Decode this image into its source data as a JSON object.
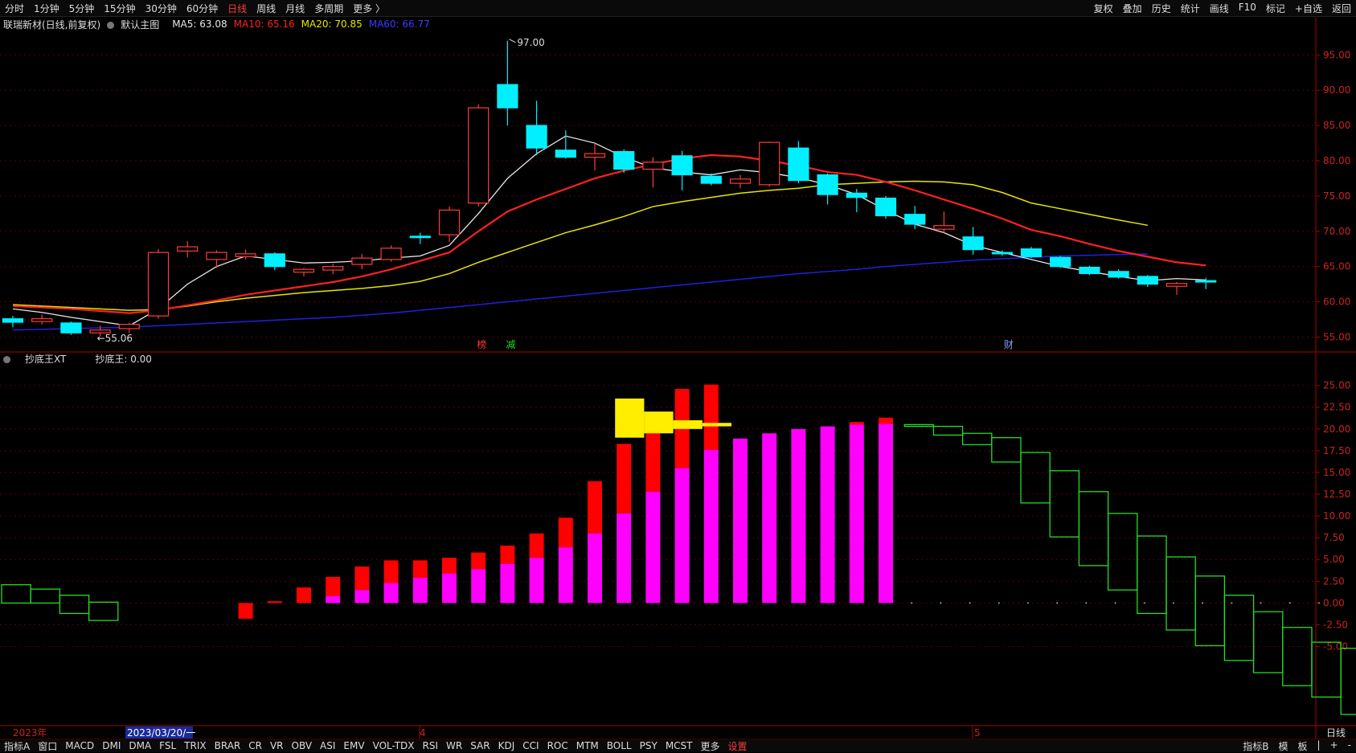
{
  "toolbar": {
    "periods": [
      "分时",
      "1分钟",
      "5分钟",
      "15分钟",
      "30分钟",
      "60分钟",
      "日线",
      "周线",
      "月线",
      "多周期",
      "更多 〉"
    ],
    "active_period": "日线",
    "right_items": [
      "复权",
      "叠加",
      "历史",
      "统计",
      "画线",
      "F10",
      "标记",
      "+自选",
      "返回"
    ]
  },
  "main_header": {
    "stock": "联瑞新材(日线,前复权)",
    "template": "默认主图",
    "ma5": "MA5: 63.08",
    "ma10": "MA10: 65.16",
    "ma20": "MA20: 70.85",
    "ma60": "MA60: 66.77"
  },
  "sub_header": {
    "indicator": "抄底王XT",
    "value": "抄底王: 0.00"
  },
  "colors": {
    "up": "#ff3b3b",
    "down": "#00f0ff",
    "ma5": "#e8e8e8",
    "ma10": "#ff2020",
    "ma20": "#e6e600",
    "ma60": "#2020e0",
    "magenta": "#ff00ff",
    "red": "#ff0000",
    "yellow": "#ffee00",
    "green": "#22dd22",
    "axis": "#aa0000",
    "label": "#cc2222"
  },
  "chart_data": [
    {
      "type": "candlestick",
      "ylim": [
        53,
        98
      ],
      "y_ticks": [
        55,
        60,
        65,
        70,
        75,
        80,
        85,
        90,
        95
      ],
      "candles": [
        {
          "o": 57.6,
          "h": 58.0,
          "l": 56.4,
          "c": 57.1
        },
        {
          "o": 57.2,
          "h": 58.2,
          "l": 56.8,
          "c": 57.6
        },
        {
          "o": 57.0,
          "h": 57.2,
          "l": 55.3,
          "c": 55.6
        },
        {
          "o": 55.6,
          "h": 56.6,
          "l": 55.1,
          "c": 56.0
        },
        {
          "o": 56.2,
          "h": 57.0,
          "l": 55.6,
          "c": 56.8
        },
        {
          "o": 58.0,
          "h": 67.5,
          "l": 57.6,
          "c": 67.0
        },
        {
          "o": 67.2,
          "h": 68.6,
          "l": 66.3,
          "c": 67.8
        },
        {
          "o": 66.0,
          "h": 67.3,
          "l": 64.8,
          "c": 67.0
        },
        {
          "o": 66.4,
          "h": 67.4,
          "l": 66.0,
          "c": 66.8
        },
        {
          "o": 66.8,
          "h": 67.0,
          "l": 64.5,
          "c": 65.0
        },
        {
          "o": 64.2,
          "h": 64.8,
          "l": 63.6,
          "c": 64.6
        },
        {
          "o": 64.5,
          "h": 65.4,
          "l": 63.9,
          "c": 65.0
        },
        {
          "o": 65.3,
          "h": 66.8,
          "l": 64.6,
          "c": 66.2
        },
        {
          "o": 66.0,
          "h": 68.0,
          "l": 65.7,
          "c": 67.6
        },
        {
          "o": 69.3,
          "h": 69.8,
          "l": 68.2,
          "c": 69.1
        },
        {
          "o": 69.5,
          "h": 73.5,
          "l": 68.5,
          "c": 73.0
        },
        {
          "o": 74.0,
          "h": 88.0,
          "l": 73.5,
          "c": 87.5
        },
        {
          "o": 90.8,
          "h": 97.0,
          "l": 85.0,
          "c": 87.5
        },
        {
          "o": 85.0,
          "h": 88.5,
          "l": 80.8,
          "c": 81.8
        },
        {
          "o": 81.5,
          "h": 84.3,
          "l": 80.3,
          "c": 80.5
        },
        {
          "o": 80.5,
          "h": 82.5,
          "l": 78.6,
          "c": 81.0
        },
        {
          "o": 81.3,
          "h": 81.6,
          "l": 78.3,
          "c": 78.8
        },
        {
          "o": 78.8,
          "h": 80.5,
          "l": 76.2,
          "c": 79.8
        },
        {
          "o": 80.7,
          "h": 81.4,
          "l": 75.8,
          "c": 78.0
        },
        {
          "o": 77.8,
          "h": 78.2,
          "l": 76.5,
          "c": 76.8
        },
        {
          "o": 76.8,
          "h": 78.0,
          "l": 76.1,
          "c": 77.4
        },
        {
          "o": 76.6,
          "h": 82.7,
          "l": 76.3,
          "c": 82.6
        },
        {
          "o": 81.8,
          "h": 82.8,
          "l": 76.8,
          "c": 77.2
        },
        {
          "o": 78.0,
          "h": 78.2,
          "l": 73.8,
          "c": 75.2
        },
        {
          "o": 75.4,
          "h": 76.0,
          "l": 72.7,
          "c": 74.8
        },
        {
          "o": 74.7,
          "h": 75.0,
          "l": 71.8,
          "c": 72.2
        },
        {
          "o": 72.4,
          "h": 73.6,
          "l": 70.3,
          "c": 71.0
        },
        {
          "o": 70.3,
          "h": 72.8,
          "l": 69.8,
          "c": 70.8
        },
        {
          "o": 69.2,
          "h": 70.6,
          "l": 66.7,
          "c": 67.4
        },
        {
          "o": 67.0,
          "h": 67.3,
          "l": 66.5,
          "c": 66.8
        },
        {
          "o": 67.5,
          "h": 67.8,
          "l": 66.2,
          "c": 66.4
        },
        {
          "o": 66.3,
          "h": 66.5,
          "l": 64.8,
          "c": 65.0
        },
        {
          "o": 64.9,
          "h": 65.1,
          "l": 63.8,
          "c": 64.0
        },
        {
          "o": 64.3,
          "h": 64.6,
          "l": 63.3,
          "c": 63.5
        },
        {
          "o": 63.6,
          "h": 63.8,
          "l": 62.1,
          "c": 62.5
        },
        {
          "o": 62.2,
          "h": 62.8,
          "l": 61.0,
          "c": 62.6
        },
        {
          "o": 63.0,
          "h": 63.4,
          "l": 61.8,
          "c": 62.8
        }
      ],
      "ma5": [
        59.0,
        58.5,
        57.8,
        57.2,
        56.6,
        59.0,
        62.5,
        65.0,
        66.5,
        66.0,
        65.5,
        65.6,
        65.8,
        66.2,
        66.5,
        68.0,
        72.5,
        77.5,
        81.0,
        83.5,
        82.5,
        80.5,
        79.0,
        78.4,
        78.0,
        78.7,
        78.3,
        77.6,
        76.6,
        75.2,
        73.0,
        71.0,
        69.8,
        68.0,
        67.0,
        66.0,
        65.0,
        64.3,
        63.6,
        63.0,
        63.3,
        63.1
      ],
      "ma10": [
        59.4,
        59.2,
        59.0,
        58.7,
        58.4,
        58.8,
        59.5,
        60.2,
        61.0,
        61.6,
        62.2,
        62.8,
        63.6,
        64.6,
        65.8,
        67.0,
        70.0,
        72.8,
        74.5,
        76.0,
        77.5,
        78.6,
        79.5,
        80.3,
        80.8,
        80.6,
        80.0,
        79.3,
        78.4,
        78.0,
        77.0,
        75.8,
        74.5,
        73.2,
        71.8,
        70.2,
        69.3,
        68.2,
        67.2,
        66.4,
        65.6,
        65.16
      ],
      "ma20": [
        59.6,
        59.4,
        59.2,
        59.0,
        58.8,
        58.9,
        59.4,
        60.0,
        60.5,
        60.9,
        61.3,
        61.6,
        61.9,
        62.3,
        62.9,
        64.0,
        65.6,
        67.0,
        68.4,
        69.8,
        70.9,
        72.1,
        73.5,
        74.2,
        74.8,
        75.4,
        75.8,
        76.1,
        76.6,
        76.8,
        77.0,
        77.1,
        77.0,
        76.6,
        75.5,
        74.0,
        73.2,
        72.4,
        71.6,
        70.85
      ],
      "ma60": [
        56.0,
        56.1,
        56.2,
        56.3,
        56.4,
        56.6,
        56.8,
        57.0,
        57.2,
        57.4,
        57.6,
        57.8,
        58.1,
        58.4,
        58.8,
        59.2,
        59.6,
        60.0,
        60.4,
        60.8,
        61.2,
        61.6,
        62.0,
        62.4,
        62.8,
        63.2,
        63.6,
        64.0,
        64.3,
        64.6,
        65.0,
        65.3,
        65.6,
        65.9,
        66.1,
        66.3,
        66.5,
        66.6,
        66.7,
        66.77
      ],
      "max_label": "97.00",
      "min_label": "←55.06",
      "annotations": [
        "榜",
        "减",
        "财"
      ]
    },
    {
      "type": "bar",
      "ylim": [
        -14,
        27
      ],
      "y_ticks": [
        -5.0,
        -2.5,
        0.0,
        2.5,
        5.0,
        7.5,
        10.0,
        12.5,
        15.0,
        17.5,
        20.0,
        22.5,
        25.0
      ],
      "red_stack": [
        [
          0,
          0
        ],
        [
          0,
          0
        ],
        [
          0,
          0
        ],
        [
          0,
          0
        ],
        [
          0,
          -1.8
        ],
        [
          0,
          0.2
        ],
        [
          0,
          1.8
        ],
        [
          0.8,
          3.0
        ],
        [
          1.5,
          4.2
        ],
        [
          2.3,
          4.9
        ],
        [
          2.9,
          4.9
        ],
        [
          3.4,
          5.2
        ],
        [
          3.9,
          5.8
        ],
        [
          4.5,
          6.6
        ],
        [
          5.2,
          8.0
        ],
        [
          6.4,
          9.8
        ],
        [
          8.0,
          14.0
        ],
        [
          10.3,
          18.3
        ],
        [
          12.8,
          21.9
        ],
        [
          15.5,
          24.6
        ],
        [
          17.6,
          25.1
        ],
        [
          18.9,
          18.9
        ],
        [
          19.5,
          19.5
        ],
        [
          20.0,
          20.0
        ],
        [
          20.3,
          20.3
        ],
        [
          20.5,
          20.8
        ],
        [
          20.6,
          21.3
        ]
      ],
      "yellow_steps": [
        [
          19.0,
          23.5
        ],
        [
          19.5,
          22.0
        ],
        [
          20.0,
          21.0
        ],
        [
          20.3,
          20.7
        ]
      ],
      "green_boxes": [
        [
          0,
          2.1
        ],
        [
          0,
          1.6
        ],
        [
          -1.2,
          0.9
        ],
        [
          -2.0,
          0.1
        ],
        [
          20.3,
          20.5
        ],
        [
          19.3,
          20.3
        ],
        [
          18.2,
          19.5
        ],
        [
          16.2,
          19.0
        ],
        [
          11.5,
          17.3
        ],
        [
          7.6,
          15.2
        ],
        [
          4.3,
          12.8
        ],
        [
          1.5,
          10.3
        ],
        [
          -1.2,
          7.7
        ],
        [
          -3.1,
          5.3
        ],
        [
          -4.9,
          3.1
        ],
        [
          -6.6,
          0.9
        ],
        [
          -8.0,
          -1.0
        ],
        [
          -9.5,
          -2.8
        ],
        [
          -10.8,
          -4.5
        ],
        [
          -12.8,
          -5.2
        ]
      ],
      "x_labels": [
        "2023年",
        "2023/03/20/一",
        "4",
        "5"
      ],
      "corner_label": "日线"
    }
  ],
  "bottom_tabs": [
    "指标A",
    "窗口",
    "MACD",
    "DMI",
    "DMA",
    "FSL",
    "TRIX",
    "BRAR",
    "CR",
    "VR",
    "OBV",
    "ASI",
    "EMV",
    "VOL-TDX",
    "RSI",
    "WR",
    "SAR",
    "KDJ",
    "CCI",
    "ROC",
    "MTM",
    "BOLL",
    "PSY",
    "MCST",
    "更多",
    "设置"
  ],
  "active_tab": "设置",
  "bottom_right": [
    "指标B",
    "模",
    "板",
    "|",
    "+",
    "-"
  ]
}
